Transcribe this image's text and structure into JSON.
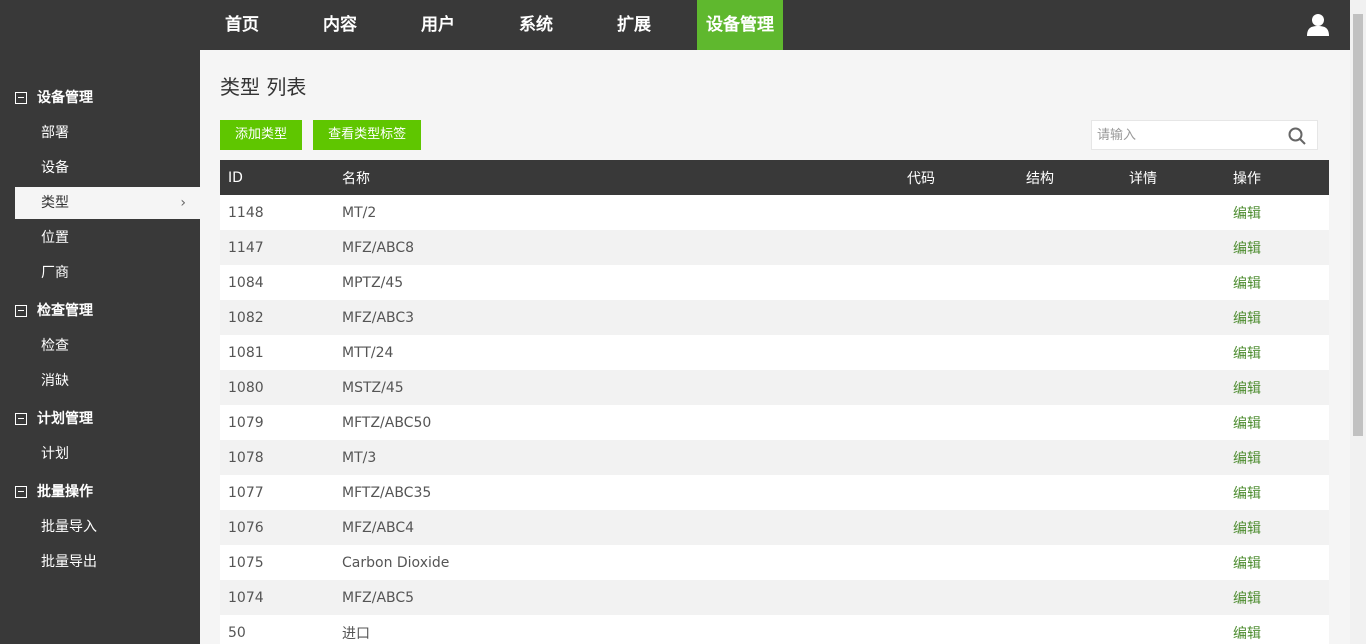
{
  "topnav": {
    "items": [
      {
        "label": "首页"
      },
      {
        "label": "内容"
      },
      {
        "label": "用户"
      },
      {
        "label": "系统"
      },
      {
        "label": "扩展"
      },
      {
        "label": "设备管理",
        "active": true
      }
    ]
  },
  "sidebar": {
    "groups": [
      {
        "title": "设备管理",
        "items": [
          "部署",
          "设备",
          "类型",
          "位置",
          "厂商"
        ]
      },
      {
        "title": "检查管理",
        "items": [
          "检查",
          "消缺"
        ]
      },
      {
        "title": "计划管理",
        "items": [
          "计划"
        ]
      },
      {
        "title": "批量操作",
        "items": [
          "批量导入",
          "批量导出"
        ]
      }
    ],
    "active_item": "类型"
  },
  "main": {
    "title": "类型 列表",
    "buttons": {
      "add": "添加类型",
      "view_tags": "查看类型标签"
    },
    "search": {
      "placeholder": "请输入",
      "value": ""
    },
    "table": {
      "columns": [
        "ID",
        "名称",
        "代码",
        "结构",
        "详情",
        "操作"
      ],
      "rows": [
        {
          "id": "1148",
          "name": "MT/2",
          "op": "编辑"
        },
        {
          "id": "1147",
          "name": "MFZ/ABC8",
          "op": "编辑"
        },
        {
          "id": "1084",
          "name": "MPTZ/45",
          "op": "编辑"
        },
        {
          "id": "1082",
          "name": "MFZ/ABC3",
          "op": "编辑"
        },
        {
          "id": "1081",
          "name": "MTT/24",
          "op": "编辑"
        },
        {
          "id": "1080",
          "name": "MSTZ/45",
          "op": "编辑"
        },
        {
          "id": "1079",
          "name": "MFTZ/ABC50",
          "op": "编辑"
        },
        {
          "id": "1078",
          "name": "MT/3",
          "op": "编辑"
        },
        {
          "id": "1077",
          "name": "MFTZ/ABC35",
          "op": "编辑"
        },
        {
          "id": "1076",
          "name": "MFZ/ABC4",
          "op": "编辑"
        },
        {
          "id": "1075",
          "name": "Carbon Dioxide",
          "op": "编辑"
        },
        {
          "id": "1074",
          "name": "MFZ/ABC5",
          "op": "编辑"
        },
        {
          "id": "50",
          "name": "进口",
          "op": "编辑"
        }
      ]
    }
  },
  "colors": {
    "accent": "#5fb82e",
    "button": "#5fc600",
    "dark": "#393939",
    "link": "#4e8d30"
  }
}
